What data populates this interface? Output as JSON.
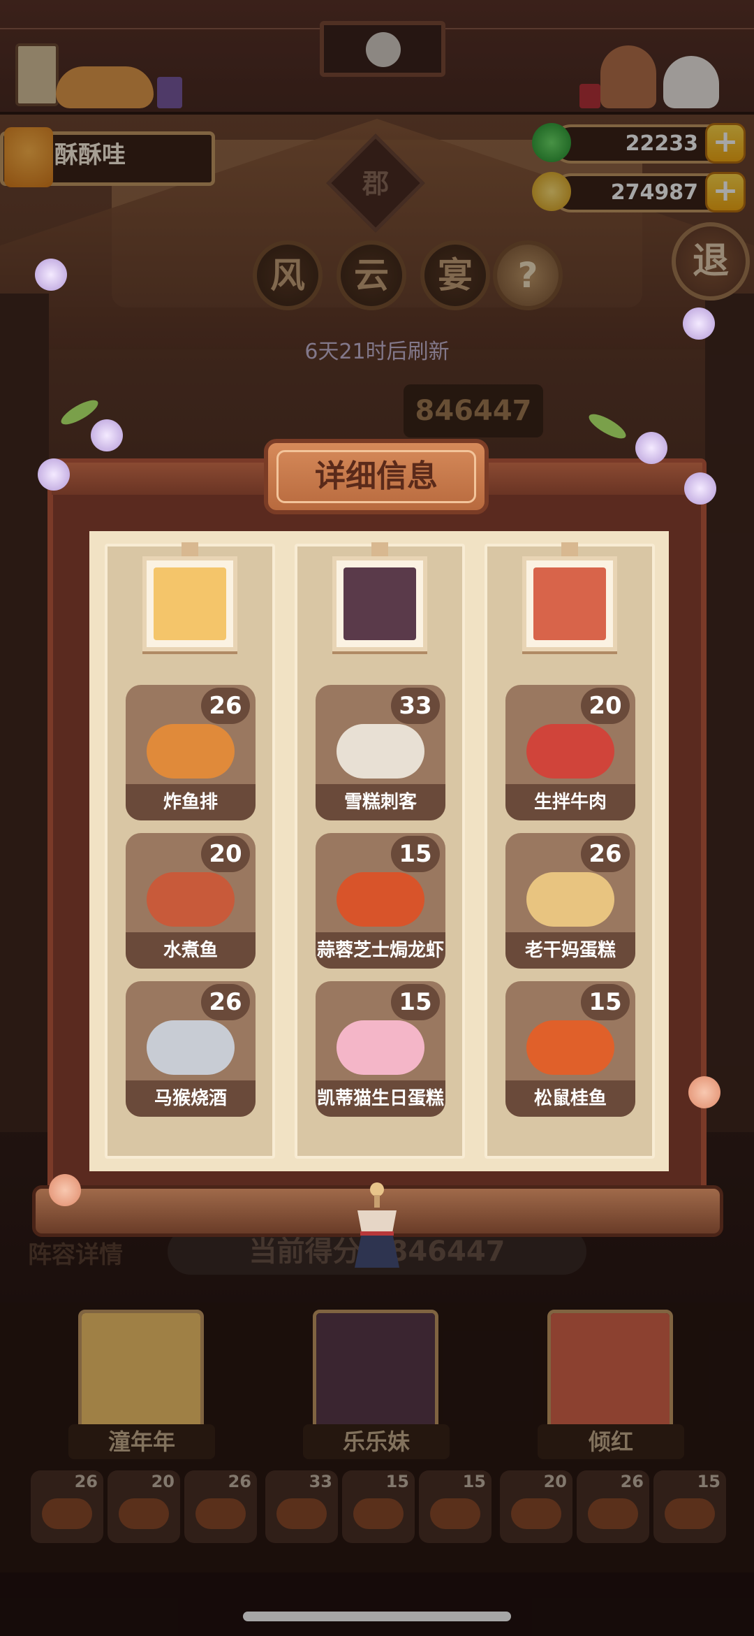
{
  "player": {
    "name": "酥酥哇"
  },
  "currency": {
    "jade": "22233",
    "coins": "274987",
    "plus_label": "+"
  },
  "header": {
    "jun_label": "郡",
    "title_chars": [
      "风",
      "云",
      "宴"
    ],
    "help_label": "?",
    "exit_label": "退",
    "refresh_text": "6天21时后刷新",
    "score": "846447"
  },
  "modal": {
    "title": "详细信息",
    "columns": [
      {
        "portrait_color": "#f4c56a",
        "dishes": [
          {
            "name": "炸鱼排",
            "count": "26",
            "color": "#e08a3a"
          },
          {
            "name": "水煮鱼",
            "count": "20",
            "color": "#c85a3a"
          },
          {
            "name": "马猴烧酒",
            "count": "26",
            "color": "#c8ccd4"
          }
        ]
      },
      {
        "portrait_color": "#5a3a4a",
        "dishes": [
          {
            "name": "雪糕刺客",
            "count": "33",
            "color": "#e8e0d4"
          },
          {
            "name": "蒜蓉芝士焗龙虾",
            "count": "15",
            "color": "#d8542a"
          },
          {
            "name": "凯蒂猫生日蛋糕",
            "count": "15",
            "color": "#f4b6c8"
          }
        ]
      },
      {
        "portrait_color": "#d8644a",
        "dishes": [
          {
            "name": "生拌牛肉",
            "count": "20",
            "color": "#d0443a"
          },
          {
            "name": "老干妈蛋糕",
            "count": "26",
            "color": "#e8c480"
          },
          {
            "name": "松鼠桂鱼",
            "count": "15",
            "color": "#e0602a"
          }
        ]
      }
    ]
  },
  "background": {
    "lineup_label": "阵容详情",
    "current_score": "当前得分：846447",
    "heroes": [
      {
        "name": "潼年年",
        "color": "#f4c56a"
      },
      {
        "name": "乐乐妹",
        "color": "#5a3a4a"
      },
      {
        "name": "倾红",
        "color": "#d8644a"
      }
    ],
    "dish_strip": [
      "26",
      "20",
      "26",
      "33",
      "15",
      "15",
      "20",
      "26",
      "15"
    ]
  }
}
